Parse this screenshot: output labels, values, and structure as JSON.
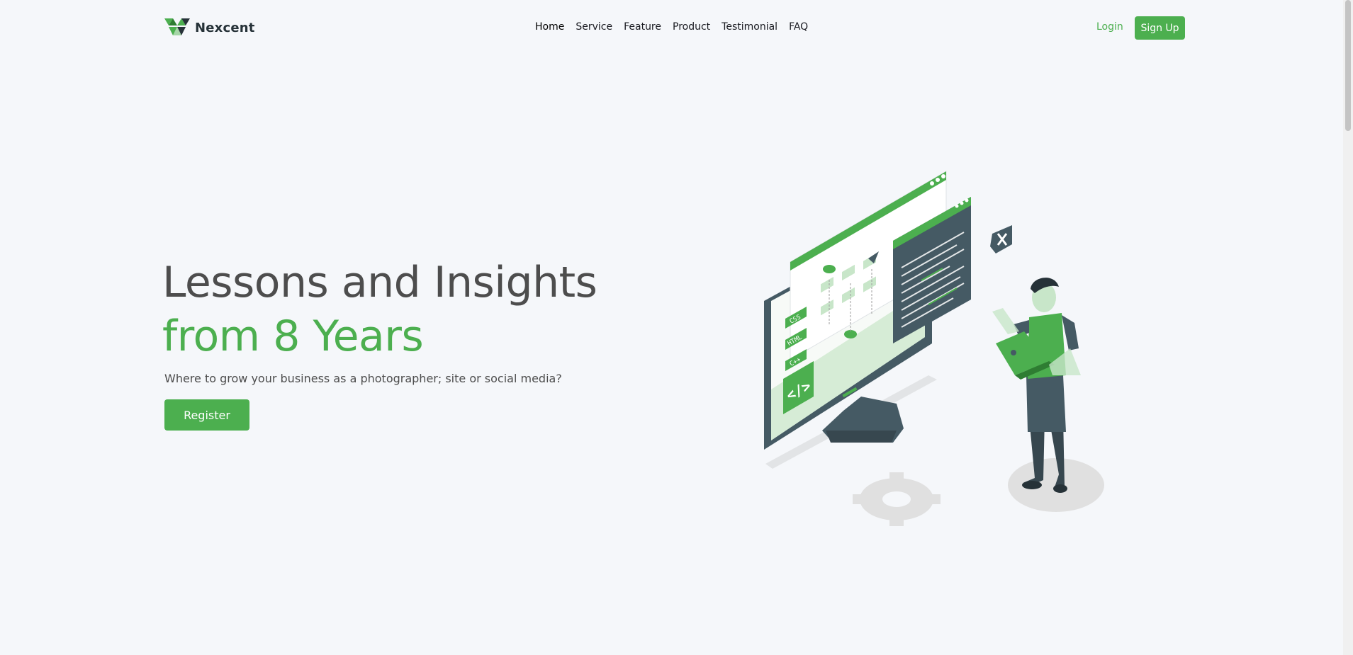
{
  "brand": {
    "name": "Nexcent",
    "logo_icon": "nexcent-logo-icon",
    "accent": "#4caf4f"
  },
  "nav": {
    "items": [
      {
        "label": "Home",
        "active": true
      },
      {
        "label": "Service"
      },
      {
        "label": "Feature"
      },
      {
        "label": "Product"
      },
      {
        "label": "Testimonial"
      },
      {
        "label": "FAQ"
      }
    ],
    "login_label": "Login",
    "signup_label": "Sign Up"
  },
  "hero": {
    "title_line1": "Lessons and Insights",
    "title_line2": "from 8 Years",
    "subtitle": "Where to grow your business as a photographer; site or social media?",
    "cta_label": "Register",
    "illustration": {
      "icon": "developer-illustration",
      "badges": [
        "CSS",
        "HTML",
        "C++"
      ],
      "code_symbol": "</>"
    }
  },
  "colors": {
    "background": "#f5f7fa",
    "text": "#4d4d4d",
    "dark": "#263238",
    "slate": "#455a64"
  }
}
